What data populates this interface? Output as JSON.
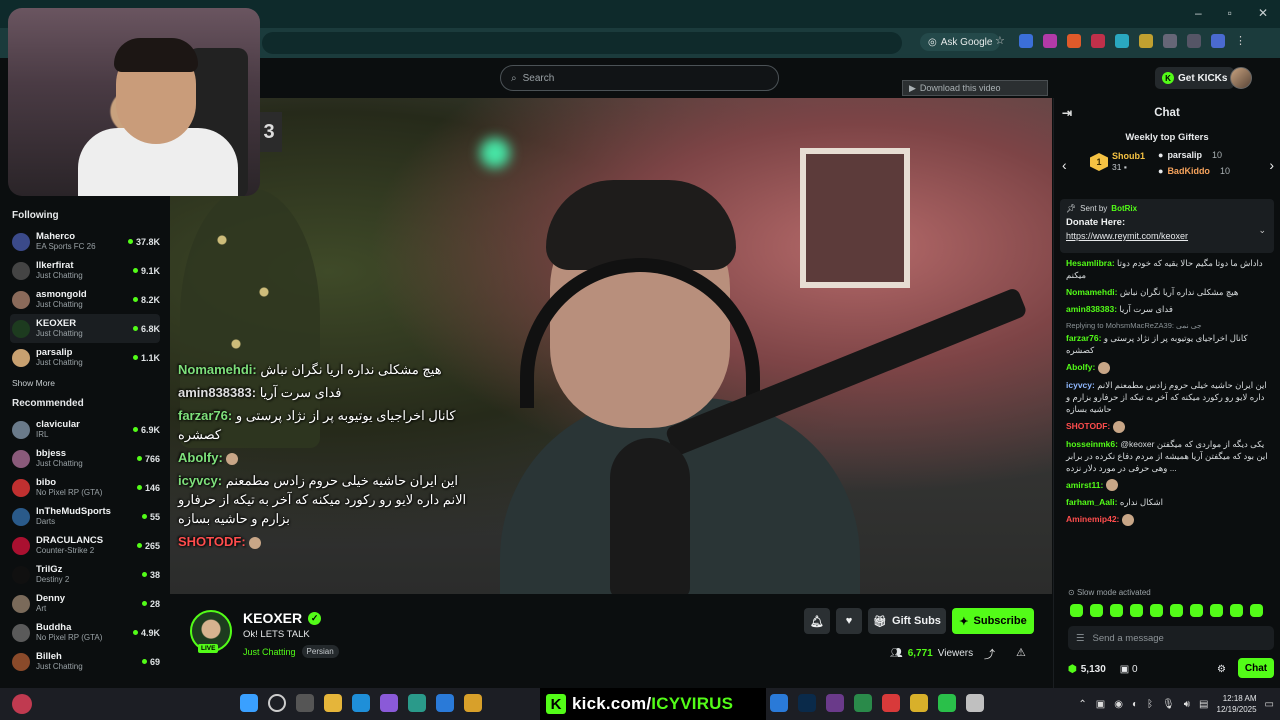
{
  "browser": {
    "ask_google": "Ask Google"
  },
  "topbar": {
    "search_placeholder": "Search",
    "download_label": "Download this video",
    "get_kicks": "Get KICKs"
  },
  "sidebar": {
    "following_title": "Following",
    "following": [
      {
        "name": "Maherco",
        "category": "EA Sports FC 26",
        "viewers": "37.8K",
        "avatar_color": "#3b4a8a"
      },
      {
        "name": "llkerfirat",
        "category": "Just Chatting",
        "viewers": "9.1K",
        "avatar_color": "#444444"
      },
      {
        "name": "asmongold",
        "category": "Just Chatting",
        "viewers": "8.2K",
        "avatar_color": "#8a6a5a"
      },
      {
        "name": "KEOXER",
        "category": "Just Chatting",
        "viewers": "6.8K",
        "avatar_color": "#1d3b1f"
      },
      {
        "name": "parsalip",
        "category": "Just Chatting",
        "viewers": "1.1K",
        "avatar_color": "#c8a070"
      }
    ],
    "show_more": "Show More",
    "recommended_title": "Recommended",
    "recommended": [
      {
        "name": "clavicular",
        "category": "IRL",
        "viewers": "6.9K",
        "avatar_color": "#6a7a8a"
      },
      {
        "name": "bbjess",
        "category": "Just Chatting",
        "viewers": "766",
        "avatar_color": "#8a5a7a"
      },
      {
        "name": "bibo",
        "category": "No Pixel RP (GTA)",
        "viewers": "146",
        "avatar_color": "#c03030"
      },
      {
        "name": "InTheMudSports",
        "category": "Darts",
        "viewers": "55",
        "avatar_color": "#2a5a8a"
      },
      {
        "name": "DRACULANCS",
        "category": "Counter-Strike 2",
        "viewers": "265",
        "avatar_color": "#aa1030"
      },
      {
        "name": "TrilGz",
        "category": "Destiny 2",
        "viewers": "38",
        "avatar_color": "#101010"
      },
      {
        "name": "Denny",
        "category": "Art",
        "viewers": "28",
        "avatar_color": "#7a6a5a"
      },
      {
        "name": "Buddha",
        "category": "No Pixel RP (GTA)",
        "viewers": "4.9K",
        "avatar_color": "#5a5a5a"
      },
      {
        "name": "Billeh",
        "category": "Just Chatting",
        "viewers": "69",
        "avatar_color": "#8a4a2a"
      }
    ]
  },
  "video": {
    "overlay_digits": "3",
    "chat": [
      {
        "user": "Nomamehdi:",
        "text": "هیچ مشکلی نداره اریا نگران نباش",
        "color": "green"
      },
      {
        "user": "amin838383:",
        "text": "فدای سرت آریا",
        "color": "white"
      },
      {
        "user": "farzar76:",
        "text": "کانال اخراجیای یوتیوبه پر از نژاد پرستی و کصشره",
        "color": "green"
      },
      {
        "user": "Abolfy:",
        "text": "",
        "color": "green"
      },
      {
        "user": "icyvcy:",
        "text": "این ایران حاشیه خیلی حروم زادس مطمعنم الانم داره لایو رو رکورد میکنه که آخر به تیکه از حرفارو بزارم و حاشیه بسازه",
        "color": "green"
      },
      {
        "user": "SHOTODF:",
        "text": "",
        "color": "red"
      }
    ]
  },
  "channel": {
    "name": "KEOXER",
    "live_label": "LIVE",
    "title": "Ok! LETS TALK",
    "category": "Just Chatting",
    "tag": "Persian",
    "gift_subs": "Gift Subs",
    "subscribe": "Subscribe",
    "viewers": "6,771",
    "viewers_label": "Viewers"
  },
  "chat": {
    "title": "Chat",
    "gifters_title": "Weekly top Gifters",
    "top_gifter": {
      "name": "Shoub1",
      "count": "31",
      "rank": "1"
    },
    "gifter2": {
      "name": "parsalip",
      "count": "10"
    },
    "gifter3": {
      "name": "BadKiddo",
      "count": "10"
    },
    "pinned": {
      "sent_by": "Sent by",
      "bot": "BotRix",
      "donate": "Donate Here:",
      "link": "https://www.reymit.com/keoxer"
    },
    "messages": [
      {
        "user": "Hesamlibra:",
        "text": "داداش ما دوتا مگیم حالا بقیه که خودم دوتا میکنم",
        "color": ""
      },
      {
        "user": "Nomamehdi:",
        "text": "هیچ مشکلی نداره آریا نگران نباش",
        "color": ""
      },
      {
        "user": "amin838383:",
        "text": "فدای سرت آریا",
        "color": ""
      },
      {
        "user": "farzar76:",
        "text": "کانال اخراجیای یوتیوبه پر از نژاد پرستی و کصشره",
        "color": "",
        "reply": "Replying to MohsmMacReZA39: جی نمی"
      },
      {
        "user": "Abolfy:",
        "text": "",
        "color": ""
      },
      {
        "user": "icyvcy:",
        "text": "این ایران حاشیه خیلی حروم زادس مطمعنم الانم داره لایو رو رکورد میکنه که آخر به تیکه از حرفارو بزارم و حاشیه بسازه",
        "color": "blue"
      },
      {
        "user": "SHOTODF:",
        "text": "",
        "color": "red"
      },
      {
        "user": "hosseinmk6:",
        "text": "@keoxer یکی دیگه از مواردی که میگفتن این بود که میگفتن آریا همیشه از مردم دفاع نکرده در برابر ... وهی حرفی در مورد دلار نزده",
        "color": ""
      },
      {
        "user": "amirst11:",
        "text": "",
        "color": ""
      },
      {
        "user": "farham_Aali:",
        "text": "اشکال نداره",
        "color": ""
      },
      {
        "user": "Aminemip42:",
        "text": "",
        "color": "red"
      }
    ],
    "slow_mode": "Slow mode activated",
    "input_placeholder": "Send a message",
    "kicks_balance": "5,130",
    "other_count": "0",
    "chat_button": "Chat"
  },
  "taskbar": {
    "banner_prefix": "kick.com/",
    "banner_name": "ICYVIRUS",
    "time": "12:18 AM",
    "date": "12/19/2025"
  },
  "colors": {
    "brand": "#53fc18",
    "background": "#0b0e0f"
  }
}
